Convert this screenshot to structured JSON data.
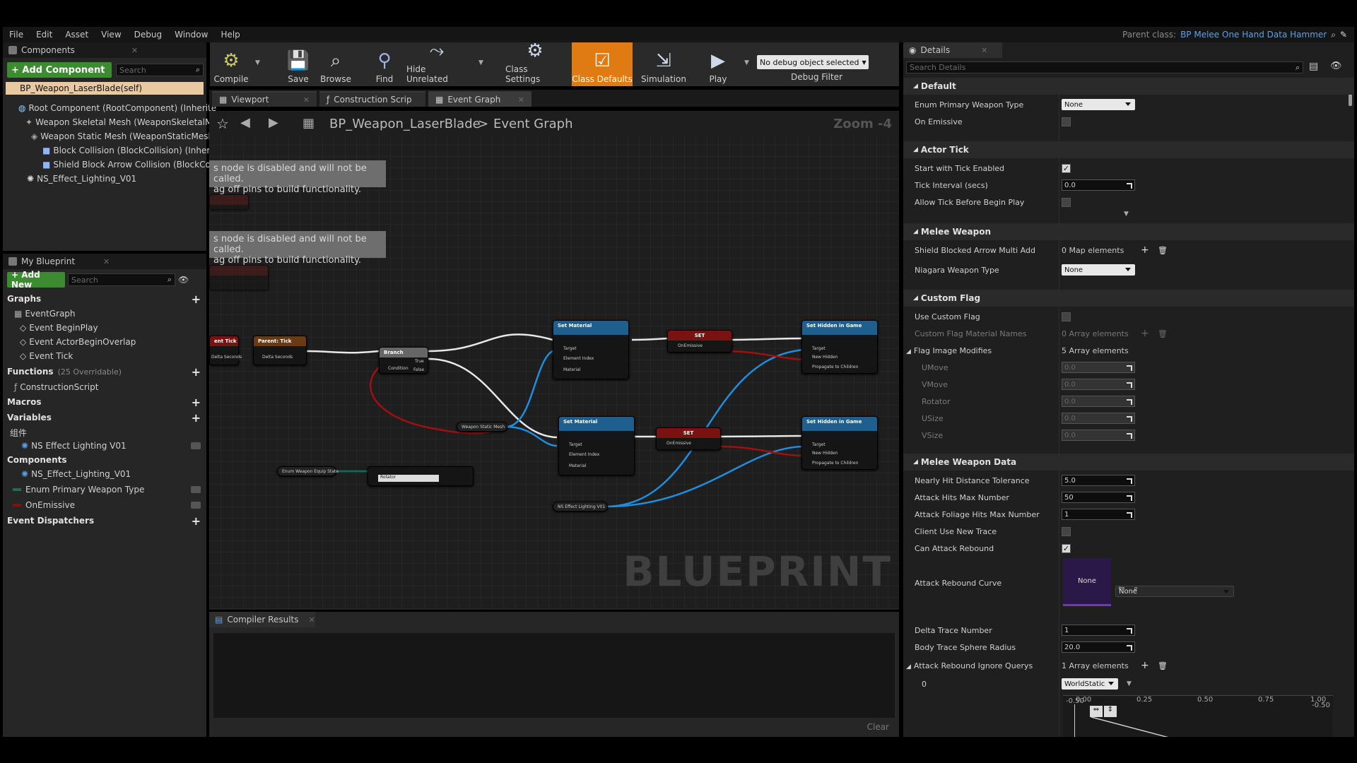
{
  "menu": [
    "File",
    "Edit",
    "Asset",
    "View",
    "Debug",
    "Window",
    "Help"
  ],
  "parent_class": {
    "label": "Parent class:",
    "value": "BP Melee One Hand Data Hammer"
  },
  "components_panel": {
    "title": "Components",
    "add_button": "+ Add Component",
    "search_placeholder": "Search",
    "self": "BP_Weapon_LaserBlade(self)",
    "items": [
      "Root Component (RootComponent) (Inherite",
      "Weapon Skeletal Mesh (WeaponSkeletalMe",
      "Weapon Static Mesh (WeaponStaticMesh",
      "Block Collision (BlockCollision) (Inherit",
      "Shield Block Arrow Collision (BlockColl",
      "NS_Effect_Lighting_V01"
    ]
  },
  "my_blueprint": {
    "title": "My Blueprint",
    "add_new": "+ Add New",
    "search_placeholder": "Search",
    "graphs_label": "Graphs",
    "graph_items": [
      "EventGraph",
      "Event BeginPlay",
      "Event ActorBeginOverlap",
      "Event Tick"
    ],
    "functions_label": "Functions",
    "functions_count": "(25 Overridable)",
    "function_items": [
      "ConstructionScript"
    ],
    "macros_label": "Macros",
    "variables_label": "Variables",
    "var_group": "组件",
    "var_items": [
      "NS Effect Lighting V01"
    ],
    "components_label": "Components",
    "component_items": [
      "NS_Effect_Lighting_V01",
      "Enum Primary Weapon Type",
      "OnEmissive"
    ],
    "dispatchers_label": "Event Dispatchers"
  },
  "toolbar": {
    "compile": "Compile",
    "save": "Save",
    "browse": "Browse",
    "find": "Find",
    "hide_unrelated": "Hide Unrelated",
    "class_settings": "Class Settings",
    "class_defaults": "Class Defaults",
    "simulation": "Simulation",
    "play": "Play",
    "debug_select": "No debug object selected",
    "debug_filter": "Debug Filter"
  },
  "editor_tabs": [
    "Viewport",
    "Construction Scrip",
    "Event Graph"
  ],
  "breadcrumb": {
    "asset": "BP_Weapon_LaserBlade",
    "sep": ">",
    "graph": "Event Graph",
    "zoom": "Zoom -4"
  },
  "graph": {
    "disabled_note_1a": "s node is disabled and will not be called.",
    "disabled_note_1b": "ag off pins to build functionality.",
    "disabled_note_2a": "s node is disabled and will not be called.",
    "disabled_note_2b": "ag off pins to build functionality.",
    "watermark": "BLUEPRINT",
    "nodes": {
      "event_tick": "ent Tick",
      "parent_tick": "Parent: Tick",
      "branch": "Branch",
      "set_material_1": "Set Material",
      "set_material_2": "Set Material",
      "set_1": "SET",
      "set_2": "SET",
      "hidden_1": "Set Hidden in Game",
      "hidden_2": "Set Hidden in Game",
      "weapon_static_mesh": "Weapon Static Mesh",
      "enum_state": "Enum Weapon Equip State",
      "ns_effect": "NS Effect Lighting V01",
      "select": "Rotator"
    },
    "pins": {
      "delta_seconds": "Delta Seconds",
      "condition": "Condition",
      "true": "True",
      "false": "False",
      "target": "Target",
      "element_index": "Element Index",
      "material": "Material",
      "on_emissive": "OnEmissive",
      "new_hidden": "New Hidden",
      "propagate": "Propagate to Children"
    }
  },
  "compiler": {
    "title": "Compiler Results",
    "clear": "Clear"
  },
  "details": {
    "title": "Details",
    "search_placeholder": "Search Details",
    "sections": {
      "default": "Default",
      "actor_tick": "Actor Tick",
      "melee_weapon": "Melee Weapon",
      "custom_flag": "Custom Flag",
      "melee_weapon_data": "Melee Weapon Data"
    },
    "rows": {
      "enum_primary": {
        "label": "Enum Primary Weapon Type",
        "value": "None"
      },
      "on_emissive": {
        "label": "On Emissive"
      },
      "start_tick": {
        "label": "Start with Tick Enabled"
      },
      "tick_interval": {
        "label": "Tick Interval (secs)",
        "value": "0.0"
      },
      "allow_tick": {
        "label": "Allow Tick Before Begin Play"
      },
      "shield_blocked": {
        "label": "Shield Blocked Arrow Multi Add",
        "value": "0 Map elements"
      },
      "niagara": {
        "label": "Niagara Weapon Type",
        "value": "None"
      },
      "use_custom_flag": {
        "label": "Use Custom Flag"
      },
      "custom_flag_names": {
        "label": "Custom Flag Material Names",
        "value": "0 Array elements"
      },
      "flag_image": {
        "label": "Flag Image Modifies",
        "value": "5 Array elements"
      },
      "umove": {
        "label": "UMove",
        "value": "0.0"
      },
      "vmove": {
        "label": "VMove",
        "value": "0.0"
      },
      "rotator": {
        "label": "Rotator",
        "value": "0.0"
      },
      "usize": {
        "label": "USize",
        "value": "0.0"
      },
      "vsize": {
        "label": "VSize",
        "value": "0.0"
      },
      "nearly_hit": {
        "label": "Nearly Hit Distance Tolerance",
        "value": "5.0"
      },
      "attack_hits": {
        "label": "Attack Hits Max Number",
        "value": "50"
      },
      "attack_foliage": {
        "label": "Attack Foliage Hits Max Number",
        "value": "1"
      },
      "client_trace": {
        "label": "Client Use New Trace"
      },
      "can_rebound": {
        "label": "Can Attack Rebound"
      },
      "rebound_curve": {
        "label": "Attack Rebound Curve",
        "thumb": "None",
        "value": "None"
      },
      "delta_trace": {
        "label": "Delta Trace Number",
        "value": "1"
      },
      "body_trace": {
        "label": "Body Trace Sphere Radius",
        "value": "20.0"
      },
      "rebound_ignore": {
        "label": "Attack Rebound Ignore Querys",
        "value": "1 Array elements"
      },
      "index0": {
        "label": "0",
        "value": "WorldStatic"
      }
    },
    "curve_ticks": [
      "0.00",
      "0.25",
      "0.50",
      "0.75",
      "1.00"
    ],
    "curve_left": "-0.50",
    "curve_right": "-0.50"
  }
}
